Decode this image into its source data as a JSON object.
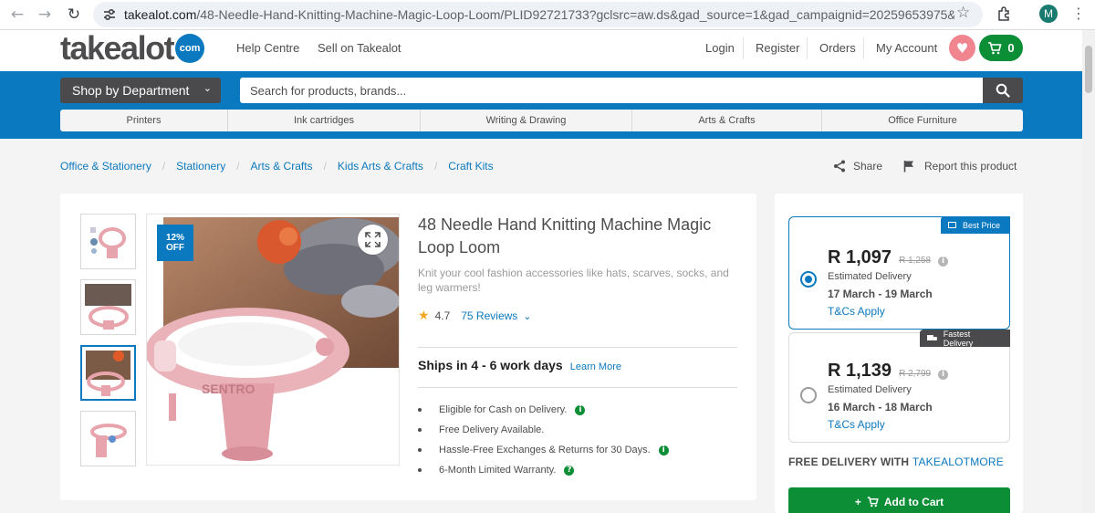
{
  "browser": {
    "url_main": "takealot.com",
    "url_rest": "/48-Needle-Hand-Knitting-Machine-Magic-Loop-Loom/PLID92721733?gclsrc=aw.ds&gad_source=1&gad_campaignid=20259653975&gbraid=0AAAAAD...",
    "profile_initial": "M"
  },
  "header": {
    "logo_text": "takealot",
    "logo_suffix": "com",
    "links": [
      "Help Centre",
      "Sell on Takealot"
    ],
    "account_links": [
      "Login",
      "Register",
      "Orders",
      "My Account"
    ],
    "cart_count": "0"
  },
  "search": {
    "dept_label": "Shop by Department",
    "placeholder": "Search for products, brands..."
  },
  "categories": [
    "Printers",
    "Ink cartridges",
    "Writing & Drawing",
    "Arts & Crafts",
    "Office Furniture"
  ],
  "breadcrumb": [
    "Office & Stationery",
    "Stationery",
    "Arts & Crafts",
    "Kids Arts & Crafts",
    "Craft Kits"
  ],
  "actions": {
    "share": "Share",
    "report": "Report this product"
  },
  "product": {
    "discount_line1": "12%",
    "discount_line2": "OFF",
    "title": "48 Needle Hand Knitting Machine Magic Loop Loom",
    "description": "Knit your cool fashion accessories like hats, scarves, socks, and leg warmers!",
    "rating": "4.7",
    "reviews": "75 Reviews",
    "shipping": "Ships in 4 - 6 work days",
    "learn_more": "Learn More",
    "features": [
      "Eligible for Cash on Delivery.",
      "Free Delivery Available.",
      "Hassle-Free Exchanges & Returns for 30 Days.",
      "6-Month Limited Warranty."
    ]
  },
  "offers": [
    {
      "tag": "Best Price",
      "price": "R 1,097",
      "was": "R 1,258",
      "est_label": "Estimated Delivery",
      "dates": "17 March - 19 March",
      "tcs": "T&Cs Apply",
      "selected": true
    },
    {
      "tag": "Fastest Delivery",
      "price": "R 1,139",
      "was": "R 2,799",
      "est_label": "Estimated Delivery",
      "dates": "16 March - 18 March",
      "tcs": "T&Cs Apply",
      "selected": false
    }
  ],
  "free_delivery": {
    "prefix": "FREE DELIVERY WITH ",
    "brand": "TAKEALOTMORE"
  },
  "add_to_cart": "Add to Cart",
  "colors": {
    "brand_blue": "#0b79bf",
    "cart_green": "#0b8e36",
    "heart_pink": "#f08590",
    "dark_grey": "#4a4a4c"
  }
}
